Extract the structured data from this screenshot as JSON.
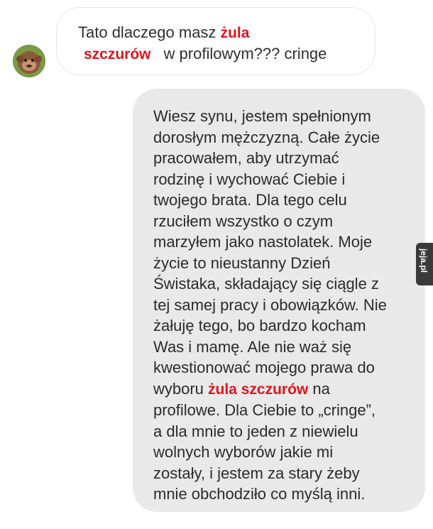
{
  "incoming": {
    "line1_plain": "Tato dlaczego masz ",
    "line1_highlight": "żula",
    "line2_highlight": "szczurów",
    "line2_rest": "w profilowym??? cringe"
  },
  "outgoing": {
    "lines_before": [
      "Wiesz synu, jestem spełnionym",
      "dorosłym mężczyzną. Całe życie",
      "pracowałem, aby utrzymać",
      "rodzinę i wychować Ciebie i",
      "twojego brata. Dla tego celu",
      "rzuciłem wszystko o czym",
      "marzyłem jako nastolatek. Moje",
      "życie to nieustanny Dzień",
      "Świstaka, składający się ciągle z",
      "tej samej pracy i obowiązków. Nie",
      "żałuję tego, bo bardzo kocham",
      "Was i mamę. Ale nie waż się",
      "kwestionować mojego prawa do"
    ],
    "highlight_line_pre": "wyboru ",
    "highlight_text": "żula szczurów",
    "highlight_line_post": " na",
    "lines_after": [
      "profilowe. Dla Ciebie to „cringe”,",
      "a dla mnie to jeden z niewielu",
      "wolnych wyborów jakie mi",
      "zostały, i jestem za stary żeby",
      "mnie obchodziło co myślą inni."
    ]
  },
  "watermark": {
    "text": "jeja.pl"
  },
  "colors": {
    "highlight": "#e0141e",
    "outgoing_bubble": "#e9e9e9",
    "incoming_border": "#e6e6e6"
  },
  "icons": {
    "avatar": "monkey-avatar-icon"
  }
}
